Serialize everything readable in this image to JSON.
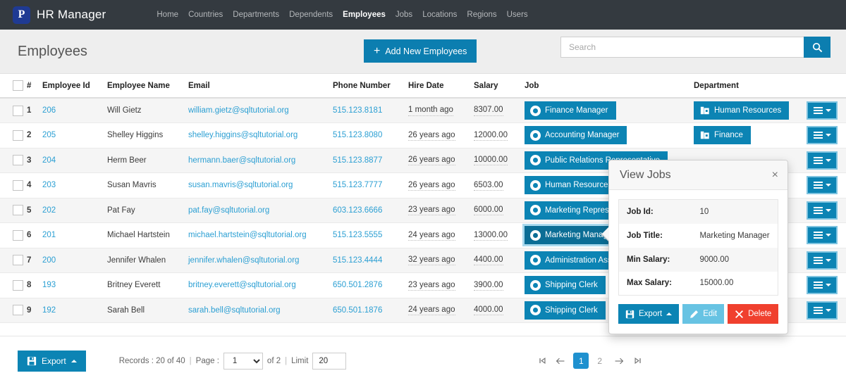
{
  "navbar": {
    "brand_initial": "P",
    "brand_name": "HR Manager",
    "links": [
      {
        "label": "Home",
        "active": false
      },
      {
        "label": "Countries",
        "active": false
      },
      {
        "label": "Departments",
        "active": false
      },
      {
        "label": "Dependents",
        "active": false
      },
      {
        "label": "Employees",
        "active": true
      },
      {
        "label": "Jobs",
        "active": false
      },
      {
        "label": "Locations",
        "active": false
      },
      {
        "label": "Regions",
        "active": false
      },
      {
        "label": "Users",
        "active": false
      }
    ]
  },
  "header": {
    "title": "Employees",
    "add_button": "Add New Employees",
    "search_placeholder": "Search",
    "search_value": ""
  },
  "table": {
    "columns": [
      "",
      "#",
      "Employee Id",
      "Employee Name",
      "Email",
      "Phone Number",
      "Hire Date",
      "Salary",
      "Job",
      "Department",
      ""
    ],
    "rows": [
      {
        "num": "1",
        "id": "206",
        "name": "Will Gietz",
        "email": "william.gietz@sqltutorial.org",
        "phone": "515.123.8181",
        "hire": "1 month ago",
        "salary": "8307.00",
        "job": "Finance Manager",
        "dept": "Human Resources",
        "job_selected": false
      },
      {
        "num": "2",
        "id": "205",
        "name": "Shelley Higgins",
        "email": "shelley.higgins@sqltutorial.org",
        "phone": "515.123.8080",
        "hire": "26 years ago",
        "salary": "12000.00",
        "job": "Accounting Manager",
        "dept": "Finance",
        "job_selected": false
      },
      {
        "num": "3",
        "id": "204",
        "name": "Herm Beer",
        "email": "hermann.baer@sqltutorial.org",
        "phone": "515.123.8877",
        "hire": "26 years ago",
        "salary": "10000.00",
        "job": "Public Relations Representative",
        "dept": "",
        "job_selected": false
      },
      {
        "num": "4",
        "id": "203",
        "name": "Susan Mavris",
        "email": "susan.mavris@sqltutorial.org",
        "phone": "515.123.7777",
        "hire": "26 years ago",
        "salary": "6503.00",
        "job": "Human Resources Representative",
        "dept": "",
        "job_selected": false
      },
      {
        "num": "5",
        "id": "202",
        "name": "Pat Fay",
        "email": "pat.fay@sqltutorial.org",
        "phone": "603.123.6666",
        "hire": "23 years ago",
        "salary": "6000.00",
        "job": "Marketing Representative",
        "dept": "",
        "job_selected": false
      },
      {
        "num": "6",
        "id": "201",
        "name": "Michael Hartstein",
        "email": "michael.hartstein@sqltutorial.org",
        "phone": "515.123.5555",
        "hire": "24 years ago",
        "salary": "13000.00",
        "job": "Marketing Manager",
        "dept": "",
        "job_selected": true
      },
      {
        "num": "7",
        "id": "200",
        "name": "Jennifer Whalen",
        "email": "jennifer.whalen@sqltutorial.org",
        "phone": "515.123.4444",
        "hire": "32 years ago",
        "salary": "4400.00",
        "job": "Administration Assistant",
        "dept": "",
        "job_selected": false
      },
      {
        "num": "8",
        "id": "193",
        "name": "Britney Everett",
        "email": "britney.everett@sqltutorial.org",
        "phone": "650.501.2876",
        "hire": "23 years ago",
        "salary": "3900.00",
        "job": "Shipping Clerk",
        "dept": "",
        "job_selected": false
      },
      {
        "num": "9",
        "id": "192",
        "name": "Sarah Bell",
        "email": "sarah.bell@sqltutorial.org",
        "phone": "650.501.1876",
        "hire": "24 years ago",
        "salary": "4000.00",
        "job": "Shipping Clerk",
        "dept": "",
        "job_selected": false
      }
    ]
  },
  "popover": {
    "title": "View Jobs",
    "close_label": "×",
    "fields": [
      {
        "key": "Job Id:",
        "value": "10"
      },
      {
        "key": "Job Title:",
        "value": "Marketing Manager"
      },
      {
        "key": "Min Salary:",
        "value": "9000.00"
      },
      {
        "key": "Max Salary:",
        "value": "15000.00"
      }
    ],
    "export_label": "Export",
    "edit_label": "Edit",
    "delete_label": "Delete"
  },
  "footer": {
    "export_label": "Export",
    "records_text": "Records : 20 of 40",
    "page_label": "Page :",
    "page_value": "1",
    "of_text": "of 2",
    "limit_label": "Limit",
    "limit_value": "20",
    "pager": {
      "first": "⏮",
      "prev": "←",
      "pages": [
        {
          "label": "1",
          "active": true
        },
        {
          "label": "2",
          "active": false
        }
      ],
      "next": "→",
      "last": "⏭"
    }
  },
  "colors": {
    "navbar_bg": "#343a40",
    "brand_logo_bg": "#1f3a93",
    "accent": "#0c84b4",
    "link": "#2b9fd3",
    "danger": "#f0402e",
    "edit": "#67c3e3",
    "page_bg": "#eeeeee"
  }
}
